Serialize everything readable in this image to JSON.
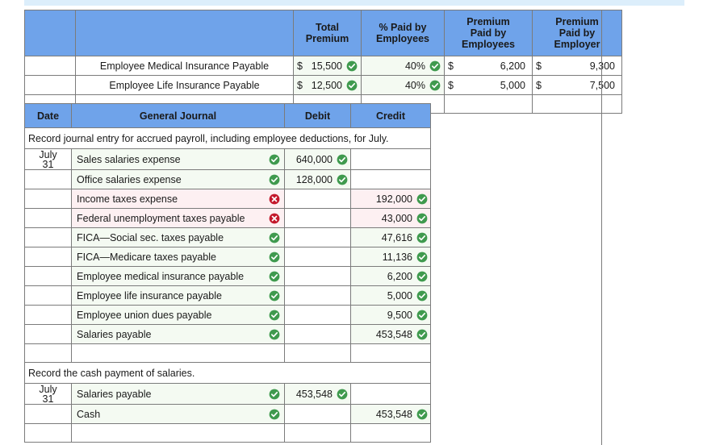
{
  "premium_table": {
    "headers": [
      "",
      "",
      "Total Premium",
      "% Paid by Employees",
      "Premium Paid by Employees",
      "Premium Paid by Employer"
    ],
    "header_lines": {
      "total_premium": [
        "Total",
        "Premium"
      ],
      "pct_paid_employees": [
        "% Paid by",
        "Employees"
      ],
      "premium_paid_employees": [
        "Premium",
        "Paid by",
        "Employees"
      ],
      "premium_paid_employer": [
        "Premium",
        "Paid by",
        "Employer"
      ]
    },
    "rows": [
      {
        "label": "Employee Medical Insurance Payable",
        "total_premium_currency": "$",
        "total_premium": "15,500",
        "total_premium_mark": "check",
        "pct_paid_employees": "40%",
        "pct_mark": "check",
        "paid_by_employees_currency": "$",
        "paid_by_employees": "6,200",
        "paid_by_employer_currency": "$",
        "paid_by_employer": "9,300"
      },
      {
        "label": "Employee Life Insurance Payable",
        "total_premium_currency": "$",
        "total_premium": "12,500",
        "total_premium_mark": "check",
        "pct_paid_employees": "40%",
        "pct_mark": "check",
        "paid_by_employees_currency": "$",
        "paid_by_employees": "5,000",
        "paid_by_employer_currency": "$",
        "paid_by_employer": "7,500"
      }
    ]
  },
  "journal": {
    "headers": {
      "date": "Date",
      "general_journal": "General Journal",
      "debit": "Debit",
      "credit": "Credit"
    },
    "entry1": {
      "note": "Record journal entry for accrued payroll, including employee deductions, for July.",
      "date_line1": "July",
      "date_line2": "31",
      "lines": [
        {
          "account": "Sales salaries expense",
          "mark": "check",
          "debit": "640,000",
          "debit_mark": "check",
          "credit": "",
          "credit_mark": "",
          "tint": "green"
        },
        {
          "account": "Office salaries expense",
          "mark": "check",
          "debit": "128,000",
          "debit_mark": "check",
          "credit": "",
          "credit_mark": "",
          "tint": "green"
        },
        {
          "account": "Income taxes expense",
          "mark": "cross",
          "debit": "",
          "debit_mark": "",
          "credit": "192,000",
          "credit_mark": "check",
          "tint": "pink"
        },
        {
          "account": "Federal unemployment taxes payable",
          "mark": "cross",
          "debit": "",
          "debit_mark": "",
          "credit": "43,000",
          "credit_mark": "check",
          "tint": "pink"
        },
        {
          "account": "FICA—Social sec. taxes payable",
          "mark": "check",
          "debit": "",
          "debit_mark": "",
          "credit": "47,616",
          "credit_mark": "check",
          "tint": "green"
        },
        {
          "account": "FICA—Medicare taxes payable",
          "mark": "check",
          "debit": "",
          "debit_mark": "",
          "credit": "11,136",
          "credit_mark": "check",
          "tint": "green"
        },
        {
          "account": "Employee medical insurance payable",
          "mark": "check",
          "debit": "",
          "debit_mark": "",
          "credit": "6,200",
          "credit_mark": "check",
          "tint": "green"
        },
        {
          "account": "Employee life insurance payable",
          "mark": "check",
          "debit": "",
          "debit_mark": "",
          "credit": "5,000",
          "credit_mark": "check",
          "tint": "green"
        },
        {
          "account": "Employee union dues payable",
          "mark": "check",
          "debit": "",
          "debit_mark": "",
          "credit": "9,500",
          "credit_mark": "check",
          "tint": "green"
        },
        {
          "account": "Salaries payable",
          "mark": "check",
          "debit": "",
          "debit_mark": "",
          "credit": "453,548",
          "credit_mark": "check",
          "tint": "green"
        }
      ]
    },
    "entry2": {
      "note": "Record the cash payment of salaries.",
      "date_line1": "July",
      "date_line2": "31",
      "lines": [
        {
          "account": "Salaries payable",
          "mark": "check",
          "debit": "453,548",
          "debit_mark": "check",
          "credit": "",
          "credit_mark": "",
          "tint": "green"
        },
        {
          "account": "Cash",
          "mark": "check",
          "debit": "",
          "debit_mark": "",
          "credit": "453,548",
          "credit_mark": "check",
          "tint": "green"
        }
      ]
    }
  },
  "colors": {
    "header_blue": "#6fa3ea",
    "top_strip": "#dceefb",
    "correct_green": "#3f9a4e",
    "incorrect_red": "#c3182b",
    "correct_tint": "#f4faf2",
    "incorrect_tint": "#fdf0f2",
    "border": "#7b7b7b"
  }
}
